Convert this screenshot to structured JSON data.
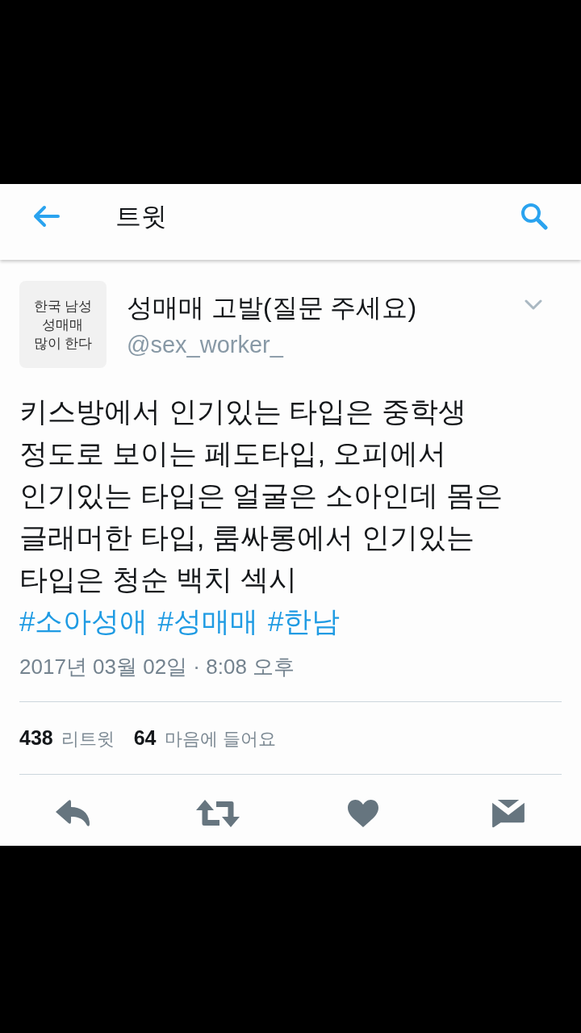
{
  "header": {
    "title": "트윗"
  },
  "tweet": {
    "avatar": {
      "lines": [
        "한국 남성",
        "성매매",
        "많이 한다"
      ]
    },
    "name": "성매매 고발(질문 주세요)",
    "handle": "@sex_worker_",
    "text": "키스방에서 인기있는 타입은 중학생 정도로 보이는 페도타입, 오피에서 인기있는 타입은 얼굴은 소아인데 몸은 글래머한 타입, 룸싸롱에서 인기있는 타입은 청순 백치 섹시",
    "hashtags": [
      "#소아성애",
      "#성매매",
      "#한남"
    ],
    "timestamp": "2017년 03월 02일 · 8:08 오후"
  },
  "stats": [
    {
      "count": "438",
      "label": "리트윗"
    },
    {
      "count": "64",
      "label": "마음에 들어요"
    }
  ],
  "actions": [
    {
      "kind": "reply"
    },
    {
      "kind": "retweet"
    },
    {
      "kind": "like"
    },
    {
      "kind": "message"
    }
  ]
}
